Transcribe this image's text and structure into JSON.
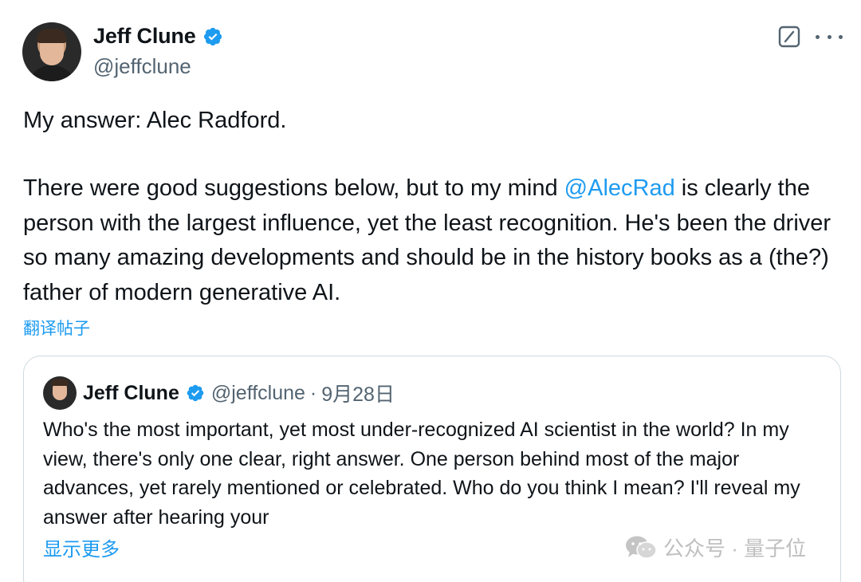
{
  "author": {
    "display_name": "Jeff Clune",
    "handle": "@jeffclune",
    "verified": true
  },
  "toolbar": {
    "grok_icon": "grok-icon",
    "more_icon": "more-icon"
  },
  "tweet": {
    "line1": "My answer: Alec Radford.",
    "para2_before": "There were good suggestions below, but to my mind ",
    "mention": "@AlecRad",
    "para2_after": "  is clearly the person with the largest influence, yet the least recognition. He's been the driver so many amazing developments and should be in the history books as a (the?) father of modern generative AI.",
    "translate_label": "翻译帖子"
  },
  "quote": {
    "display_name": "Jeff Clune",
    "handle": "@jeffclune",
    "separator": "·",
    "date": "9月28日",
    "text": "Who's the most important, yet most under-recognized AI scientist in the world? In my view, there's only one clear, right answer. One person behind most of the major advances, yet rarely mentioned or celebrated. Who do you think I mean? I'll reveal my answer after hearing your",
    "show_more_label": "显示更多"
  },
  "watermark": {
    "text": "公众号 · 量子位"
  },
  "colors": {
    "link": "#1d9bf0",
    "secondary_text": "#536471",
    "border": "#cfd9de",
    "verified": "#1d9bf0"
  }
}
